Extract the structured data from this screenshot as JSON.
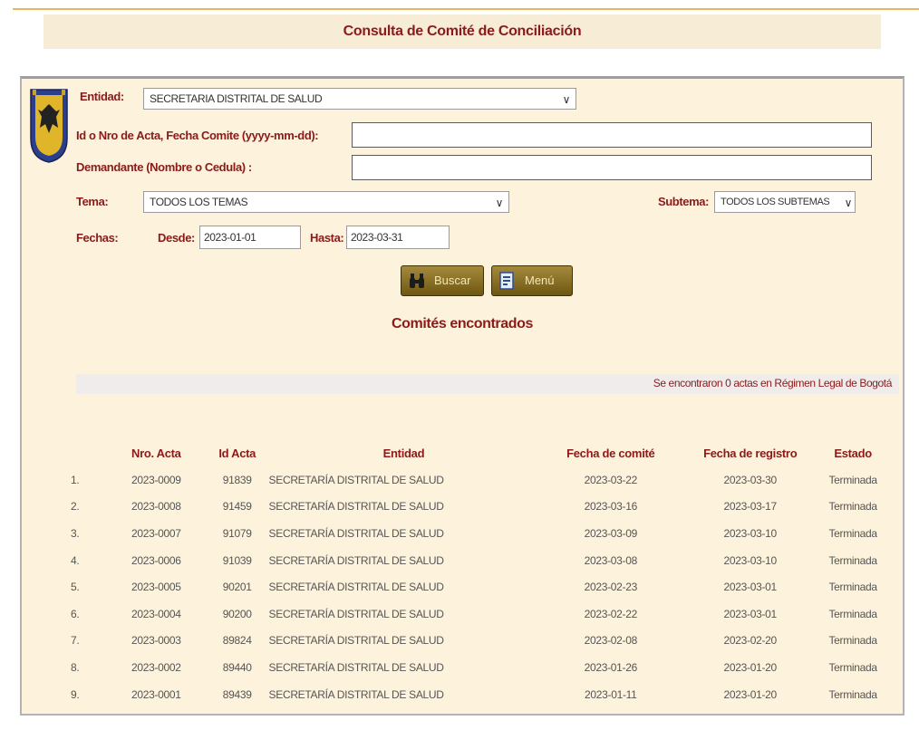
{
  "page": {
    "title": "Consulta de Comité de Conciliación"
  },
  "form": {
    "entidad_label": "Entidad:",
    "entidad_value": "SECRETARIA DISTRITAL DE SALUD",
    "acta_label": "Id o Nro de Acta, Fecha Comite (yyyy-mm-dd):",
    "acta_value": "",
    "demandante_label": "Demandante (Nombre o Cedula) :",
    "demandante_value": "",
    "tema_label": "Tema:",
    "tema_value": "TODOS LOS TEMAS",
    "subtema_label": "Subtema:",
    "subtema_value": "TODOS LOS SUBTEMAS",
    "fechas_label": "Fechas:",
    "desde_label": "Desde:",
    "desde_value": "2023-01-01",
    "hasta_label": "Hasta:",
    "hasta_value": "2023-03-31"
  },
  "buttons": {
    "buscar": "Buscar",
    "menu": "Menú"
  },
  "results": {
    "title": "Comités encontrados",
    "info": "Se encontraron 0 actas en Régimen Legal de Bogotá",
    "headers": [
      "Nro. Acta",
      "Id Acta",
      "Entidad",
      "Fecha de comité",
      "Fecha de registro",
      "Estado"
    ],
    "rows": [
      {
        "n": "1.",
        "acta": "2023-0009",
        "id": "91839",
        "entidad": "SECRETARÍA DISTRITAL DE SALUD",
        "fecha_comite": "2023-03-22",
        "fecha_registro": "2023-03-30",
        "estado": "Terminada"
      },
      {
        "n": "2.",
        "acta": "2023-0008",
        "id": "91459",
        "entidad": "SECRETARÍA DISTRITAL DE SALUD",
        "fecha_comite": "2023-03-16",
        "fecha_registro": "2023-03-17",
        "estado": "Terminada"
      },
      {
        "n": "3.",
        "acta": "2023-0007",
        "id": "91079",
        "entidad": "SECRETARÍA DISTRITAL DE SALUD",
        "fecha_comite": "2023-03-09",
        "fecha_registro": "2023-03-10",
        "estado": "Terminada"
      },
      {
        "n": "4.",
        "acta": "2023-0006",
        "id": "91039",
        "entidad": "SECRETARÍA DISTRITAL DE SALUD",
        "fecha_comite": "2023-03-08",
        "fecha_registro": "2023-03-10",
        "estado": "Terminada"
      },
      {
        "n": "5.",
        "acta": "2023-0005",
        "id": "90201",
        "entidad": "SECRETARÍA DISTRITAL DE SALUD",
        "fecha_comite": "2023-02-23",
        "fecha_registro": "2023-03-01",
        "estado": "Terminada"
      },
      {
        "n": "6.",
        "acta": "2023-0004",
        "id": "90200",
        "entidad": "SECRETARÍA DISTRITAL DE SALUD",
        "fecha_comite": "2023-02-22",
        "fecha_registro": "2023-03-01",
        "estado": "Terminada"
      },
      {
        "n": "7.",
        "acta": "2023-0003",
        "id": "89824",
        "entidad": "SECRETARÍA DISTRITAL DE SALUD",
        "fecha_comite": "2023-02-08",
        "fecha_registro": "2023-02-20",
        "estado": "Terminada"
      },
      {
        "n": "8.",
        "acta": "2023-0002",
        "id": "89440",
        "entidad": "SECRETARÍA DISTRITAL DE SALUD",
        "fecha_comite": "2023-01-26",
        "fecha_registro": "2023-01-20",
        "estado": "Terminada"
      },
      {
        "n": "9.",
        "acta": "2023-0001",
        "id": "89439",
        "entidad": "SECRETARÍA DISTRITAL DE SALUD",
        "fecha_comite": "2023-01-11",
        "fecha_registro": "2023-01-20",
        "estado": "Terminada"
      }
    ]
  },
  "icons": {
    "shield": "bogota-coat-of-arms-icon",
    "buscar": "binoculars-icon",
    "menu": "document-icon",
    "chevron": "chevron-down-icon"
  },
  "colors": {
    "accent": "#8b1a1a",
    "panel_bg": "#fdf2dc",
    "button_bg": "#8a7024"
  }
}
